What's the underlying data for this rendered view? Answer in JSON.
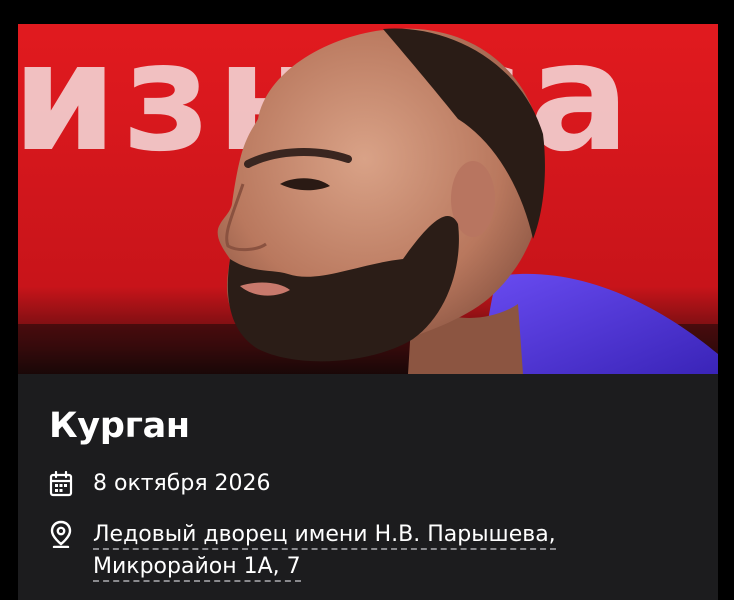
{
  "hero": {
    "backdrop_text": "изнеса",
    "colors": {
      "backdrop": "#d8161b",
      "hoodie": "#5b3fe0"
    }
  },
  "event": {
    "city": "Курган",
    "date": "8 октября 2026",
    "venue_line1": "Ледовый дворец имени Н.В. Парышева,",
    "venue_line2": "Микрорайон 1А, 7"
  },
  "icons": {
    "date": "calendar-icon",
    "venue": "location-pin-icon"
  },
  "colors": {
    "card_bg": "#1c1c1e",
    "text": "#ffffff",
    "underline": "#8a8a8e"
  }
}
